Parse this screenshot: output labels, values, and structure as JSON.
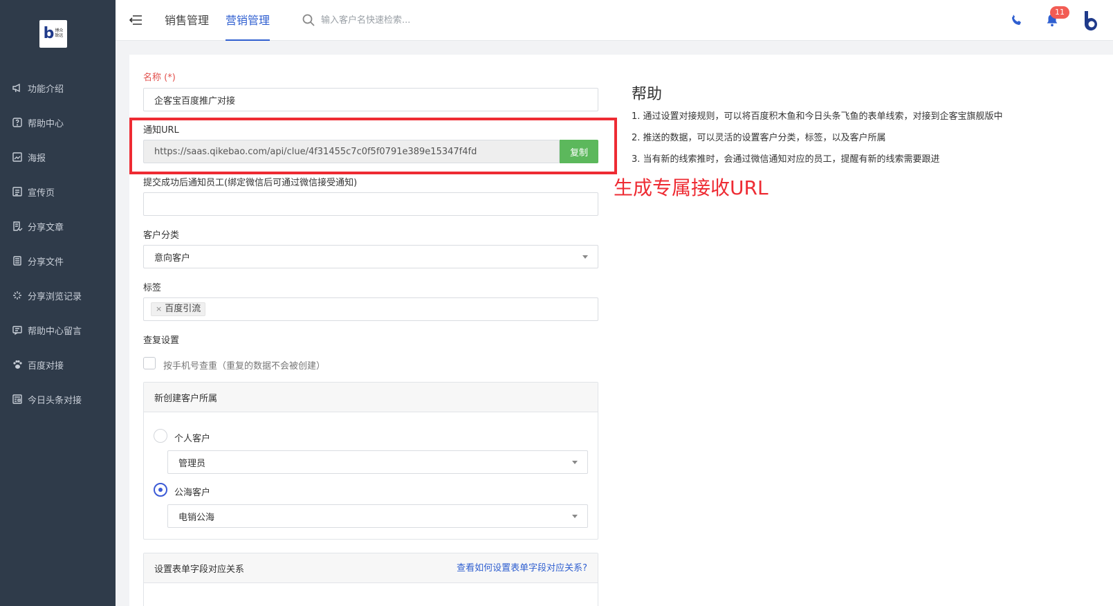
{
  "logo": {
    "text": "博众\n致远",
    "mark": "b"
  },
  "sidebar": {
    "items": [
      {
        "label": "功能介绍",
        "icon": "megaphone-icon"
      },
      {
        "label": "帮助中心",
        "icon": "help-icon"
      },
      {
        "label": "海报",
        "icon": "poster-icon"
      },
      {
        "label": "宣传页",
        "icon": "page-icon"
      },
      {
        "label": "分享文章",
        "icon": "article-icon"
      },
      {
        "label": "分享文件",
        "icon": "file-icon"
      },
      {
        "label": "分享浏览记录",
        "icon": "spark-icon"
      },
      {
        "label": "帮助中心留言",
        "icon": "message-icon"
      },
      {
        "label": "百度对接",
        "icon": "paw-icon"
      },
      {
        "label": "今日头条对接",
        "icon": "news-icon"
      }
    ]
  },
  "topbar": {
    "tabs": [
      {
        "label": "销售管理",
        "active": false
      },
      {
        "label": "营销管理",
        "active": true
      }
    ],
    "search_placeholder": "输入客户名快速检索...",
    "notification_count": "11",
    "accent": "#2f5fd0"
  },
  "form": {
    "name_label": "名称 (*)",
    "name_value": "企客宝百度推广对接",
    "url_label": "通知URL",
    "url_value": "https://saas.qikebao.com/api/clue/4f31455c7c0f5f0791e389e15347f4fd",
    "copy_label": "复制",
    "notify_label": "提交成功后通知员工(绑定微信后可通过微信接受通知)",
    "notify_value": "",
    "category_label": "客户分类",
    "category_value": "意向客户",
    "tag_label": "标签",
    "tag_value": "百度引流",
    "dup_label": "查复设置",
    "dup_checkbox": "按手机号查重（重复的数据不会被创建）",
    "owner_panel_title": "新创建客户所属",
    "personal_label": "个人客户",
    "personal_value": "管理员",
    "public_label": "公海客户",
    "public_value": "电销公海",
    "mapping_panel_title": "设置表单字段对应关系",
    "mapping_link": "查看如何设置表单字段对应关系?"
  },
  "help": {
    "title": "帮助",
    "lines": [
      "1. 通过设置对接规则，可以将百度积木鱼和今日头条飞鱼的表单线索，对接到企客宝旗舰版中",
      "2. 推送的数据，可以灵活的设置客户分类，标签，以及客户所属",
      "3. 当有新的线索推时，会通过微信通知对应的员工，提醒有新的线索需要跟进"
    ]
  },
  "annotation": {
    "text": "生成专属接收URL",
    "color": "#ee2b33"
  }
}
